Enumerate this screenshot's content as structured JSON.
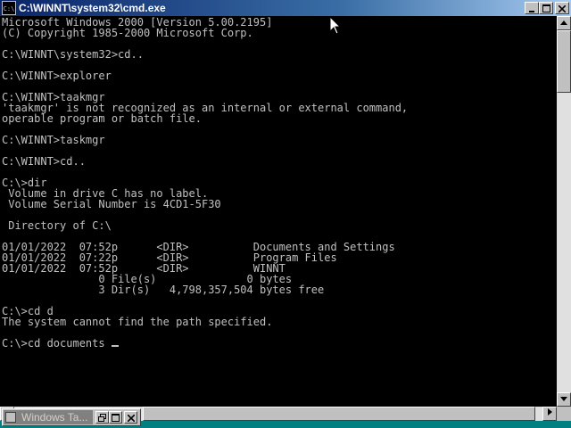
{
  "window": {
    "title": "C:\\WINNT\\system32\\cmd.exe",
    "icon_label": "C:\\",
    "buttons": {
      "minimize_icon": "minimize-icon",
      "maximize_icon": "maximize-icon",
      "close_icon": "close-icon"
    }
  },
  "console": {
    "lines": [
      "Microsoft Windows 2000 [Version 5.00.2195]",
      "(C) Copyright 1985-2000 Microsoft Corp.",
      "",
      "C:\\WINNT\\system32>cd..",
      "",
      "C:\\WINNT>explorer",
      "",
      "C:\\WINNT>taakmgr",
      "'taakmgr' is not recognized as an internal or external command,",
      "operable program or batch file.",
      "",
      "C:\\WINNT>taskmgr",
      "",
      "C:\\WINNT>cd..",
      "",
      "C:\\>dir",
      " Volume in drive C has no label.",
      " Volume Serial Number is 4CD1-5F30",
      "",
      " Directory of C:\\",
      "",
      "01/01/2022  07:52p      <DIR>          Documents and Settings",
      "01/01/2022  07:22p      <DIR>          Program Files",
      "01/01/2022  07:52p      <DIR>          WINNT",
      "               0 File(s)              0 bytes",
      "               3 Dir(s)   4,798,357,504 bytes free",
      "",
      "C:\\>cd d",
      "The system cannot find the path specified.",
      ""
    ],
    "current_input": "C:\\>cd documents "
  },
  "minimized_window": {
    "title": "Windows Ta...",
    "buttons": {
      "restore_icon": "restore-icon",
      "maximize_icon": "maximize-icon",
      "close_icon": "close-icon"
    }
  },
  "colors": {
    "console_bg": "#000000",
    "console_fg": "#c0c0c0",
    "titlebar_active": "#0a246a",
    "desktop": "#008080"
  }
}
